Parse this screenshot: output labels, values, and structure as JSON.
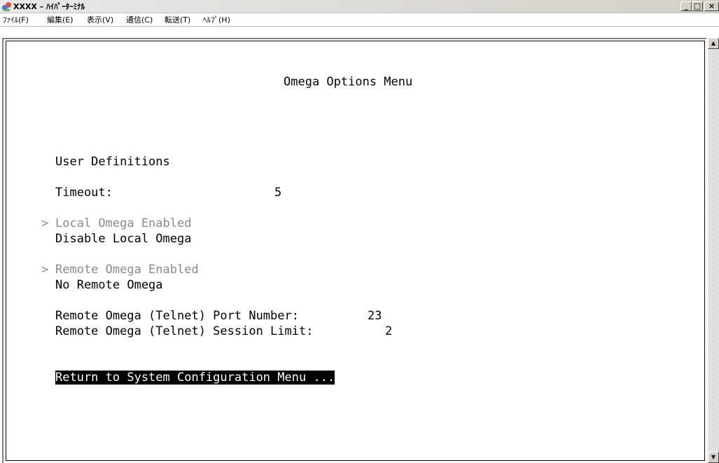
{
  "window": {
    "title": "XXXX – ﾊｲﾊﾟｰﾀｰﾐﾅﾙ",
    "minimize_label": "_",
    "maximize_label": "□",
    "close_label": "×"
  },
  "menubar": {
    "items": [
      "ﾌｧｲﾙ(F)",
      "編集(E)",
      "表示(V)",
      "通信(C)",
      "転送(T)",
      "ﾍﾙﾌﾟ(H)"
    ]
  },
  "terminal": {
    "heading": "Omega Options Menu",
    "user_definitions": "User Definitions",
    "timeout_label": "Timeout:",
    "timeout_value": "5",
    "local_selector": ">",
    "local_enabled": "Local Omega Enabled",
    "local_disable": "Disable Local Omega",
    "remote_selector": ">",
    "remote_enabled": "Remote Omega Enabled",
    "remote_none": "No Remote Omega",
    "port_label": "Remote Omega (Telnet) Port Number:",
    "port_value": "23",
    "session_label": "Remote Omega (Telnet) Session Limit:",
    "session_value": "2",
    "return_label": "Return to System Configuration Menu ..."
  },
  "colors": {
    "text": "#000000",
    "dim_text": "#8a8a8a",
    "highlight_bg": "#000000",
    "highlight_fg": "#ffffff"
  },
  "icons": {
    "app": "hyperterminal-icon",
    "scroll_up": "scroll-up-arrow-icon",
    "scroll_down": "scroll-down-arrow-icon"
  }
}
